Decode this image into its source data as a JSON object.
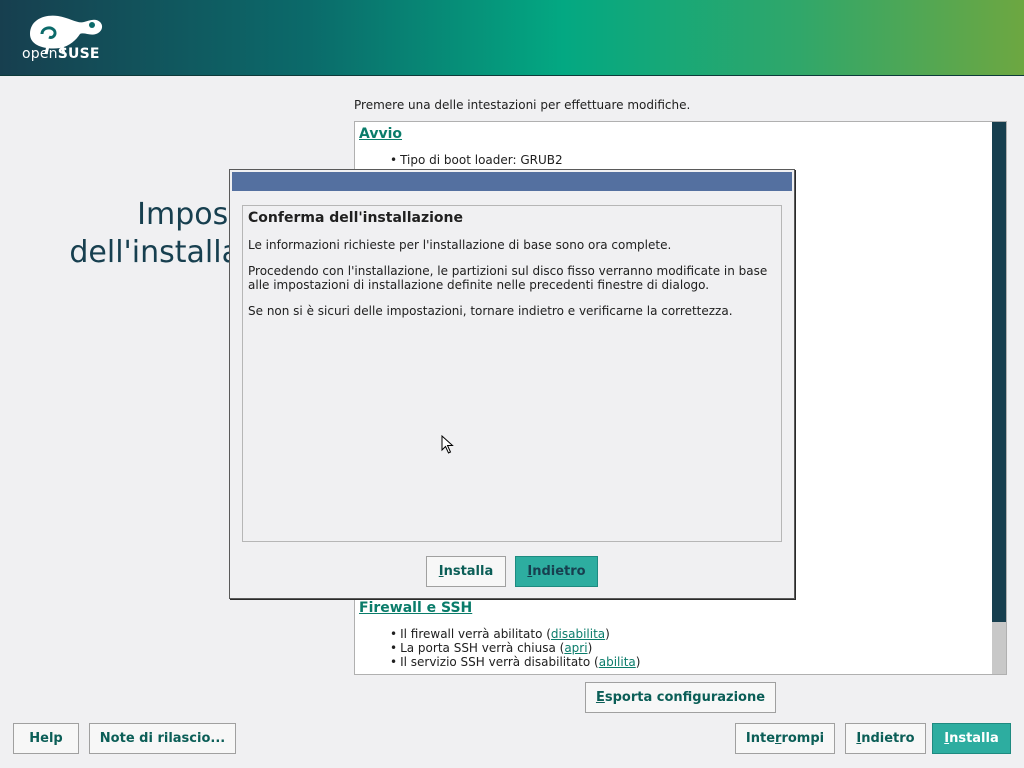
{
  "brand": {
    "name_prefix": "open",
    "name_suffix": "SUSE"
  },
  "page": {
    "title_line1": "Impost",
    "title_line2": "dell'installa",
    "hint": "Premere una delle intestazioni per effettuare modifiche."
  },
  "summary": {
    "boot": {
      "heading": "Avvio",
      "items": [
        "Tipo di boot loader: GRUB2"
      ]
    },
    "firewall": {
      "heading": "Firewall e SSH",
      "item1_text": "Il firewall verrà abilitato (",
      "item1_link": "disabilita",
      "item1_end": ")",
      "item2_text": "La porta SSH verrà chiusa (",
      "item2_link": "apri",
      "item2_end": ")",
      "item3_text": "Il servizio SSH verrà disabilitato (",
      "item3_link": "abilita",
      "item3_end": ")"
    }
  },
  "dialog": {
    "title": "Conferma dell'installazione",
    "p1": "Le informazioni richieste per l'installazione di base sono ora complete.",
    "p2": "Procedendo con l'installazione, le partizioni sul disco fisso verranno modificate in base alle impostazioni di installazione definite nelle precedenti finestre di dialogo.",
    "p3": "Se non si è sicuri delle impostazioni, tornare indietro e verificarne la correttezza.",
    "install_first": "I",
    "install_rest": "nstalla",
    "back_first": "I",
    "back_rest": "ndietro"
  },
  "buttons": {
    "export_first": "E",
    "export_rest": "sporta configurazione",
    "help": "Help",
    "notes": "Note di rilascio...",
    "abort_pre": "Inte",
    "abort_u": "r",
    "abort_post": "rompi",
    "back_first": "I",
    "back_rest": "ndietro",
    "install_first": "I",
    "install_rest": "nstalla"
  },
  "colors": {
    "accent": "#2dada0",
    "link": "#0a7c6a",
    "dark": "#173f4f",
    "titlebar": "#5470a0"
  },
  "icons": [
    "chameleon-logo-icon",
    "mouse-pointer-icon"
  ]
}
